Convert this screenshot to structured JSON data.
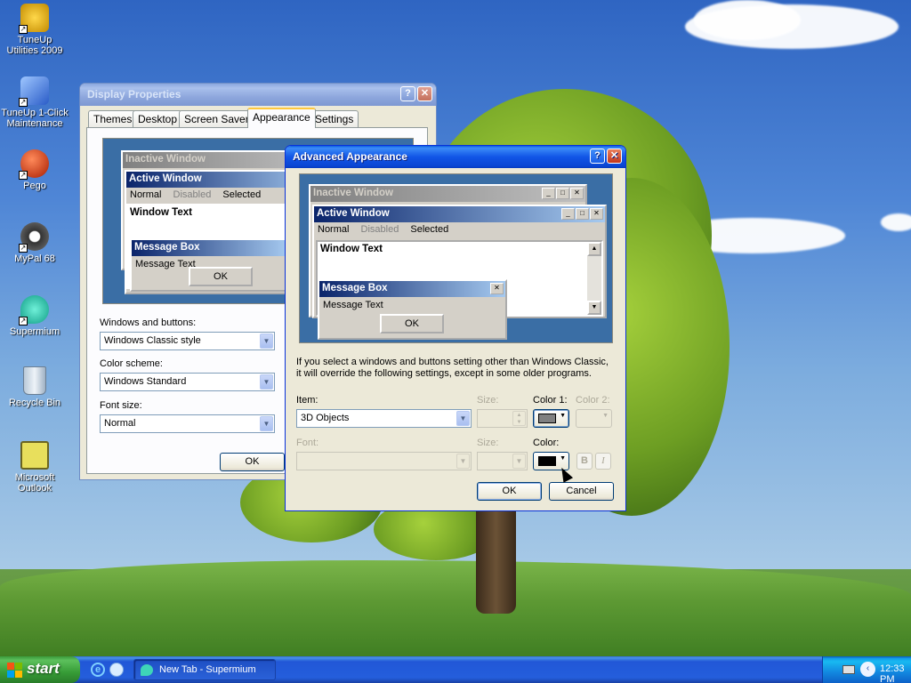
{
  "desktop": {
    "icons": [
      {
        "label": "TuneUp Utilities 2009",
        "icon": "tuneup-utilities-icon"
      },
      {
        "label": "TuneUp 1-Click Maintenance",
        "icon": "tuneup-maintenance-icon"
      },
      {
        "label": "Pego",
        "icon": "pego-icon"
      },
      {
        "label": "MyPal 68",
        "icon": "mypal-icon"
      },
      {
        "label": "Supermium",
        "icon": "supermium-icon"
      },
      {
        "label": "Recycle Bin",
        "icon": "recycle-bin-icon"
      },
      {
        "label": "Microsoft Outlook",
        "icon": "outlook-icon"
      }
    ]
  },
  "display_properties": {
    "title": "Display Properties",
    "tabs": [
      "Themes",
      "Desktop",
      "Screen Saver",
      "Appearance",
      "Settings"
    ],
    "active_tab": "Appearance",
    "preview": {
      "inactive_title": "Inactive Window",
      "active_title": "Active Window",
      "menu": [
        "Normal",
        "Disabled",
        "Selected"
      ],
      "window_text": "Window Text",
      "msgbox_title": "Message Box",
      "msgbox_text": "Message Text",
      "ok": "OK"
    },
    "windows_buttons_label": "Windows and buttons:",
    "windows_buttons_value": "Windows Classic style",
    "color_scheme_label": "Color scheme:",
    "color_scheme_value": "Windows Standard",
    "font_size_label": "Font size:",
    "font_size_value": "Normal",
    "ok": "OK"
  },
  "advanced": {
    "title": "Advanced Appearance",
    "preview": {
      "inactive_title": "Inactive Window",
      "active_title": "Active Window",
      "menu": [
        "Normal",
        "Disabled",
        "Selected"
      ],
      "window_text": "Window Text",
      "msgbox_title": "Message Box",
      "msgbox_text": "Message Text",
      "ok": "OK"
    },
    "info_line1": "If you select a windows and buttons setting other than Windows Classic,",
    "info_line2": "it will override the following settings, except in some older programs.",
    "item_label": "Item:",
    "item_value": "3D Objects",
    "size_label": "Size:",
    "color1_label": "Color 1:",
    "color2_label": "Color 2:",
    "font_label": "Font:",
    "font_size_label": "Size:",
    "color_label": "Color:",
    "bold": "B",
    "italic": "I",
    "ok": "OK",
    "cancel": "Cancel",
    "color1_swatch": "#808080",
    "color_swatch": "#000000"
  },
  "taskbar": {
    "start": "start",
    "task": "New Tab - Supermium",
    "clock": "12:33 PM"
  }
}
